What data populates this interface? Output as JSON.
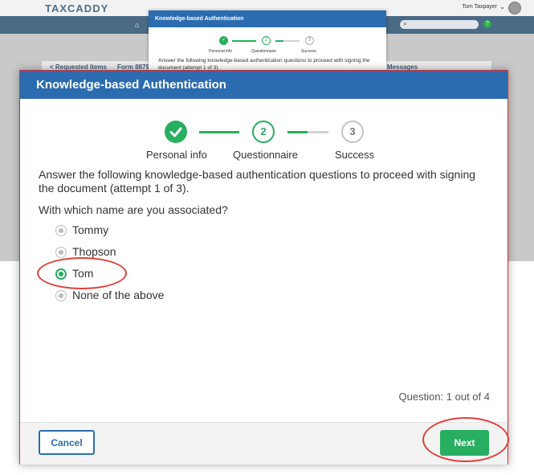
{
  "background": {
    "logo": "TAXCADDY",
    "user_name": "Tom Taxpayer",
    "tabs": [
      "< Requested Items",
      "Form 8879",
      "Messages"
    ]
  },
  "small_modal": {
    "title": "Knowledge-based Authentication",
    "steps": [
      "Personal info",
      "Questionnaire",
      "Success"
    ],
    "text": "Answer the following knowledge-based authentication questions to proceed with signing the document (attempt 1 of 3)."
  },
  "modal": {
    "title": "Knowledge-based Authentication",
    "steps": [
      {
        "number": "✓",
        "label": "Personal info",
        "status": "complete"
      },
      {
        "number": "2",
        "label": "Questionnaire",
        "status": "current"
      },
      {
        "number": "3",
        "label": "Success",
        "status": "pending"
      }
    ],
    "instructions": "Answer the following knowledge-based authentication questions to proceed with signing the document (attempt 1 of 3).",
    "question": "With which name are you associated?",
    "options": [
      {
        "label": "Tommy",
        "selected": false
      },
      {
        "label": "Thopson",
        "selected": false
      },
      {
        "label": "Tom",
        "selected": true
      },
      {
        "label": "None of the above",
        "selected": false
      }
    ],
    "progress": "Question: 1 out of 4",
    "cancel_label": "Cancel",
    "next_label": "Next"
  },
  "colors": {
    "header_blue": "#2b6cb0",
    "success_green": "#27ae60",
    "annotation_red": "#e0403b"
  }
}
